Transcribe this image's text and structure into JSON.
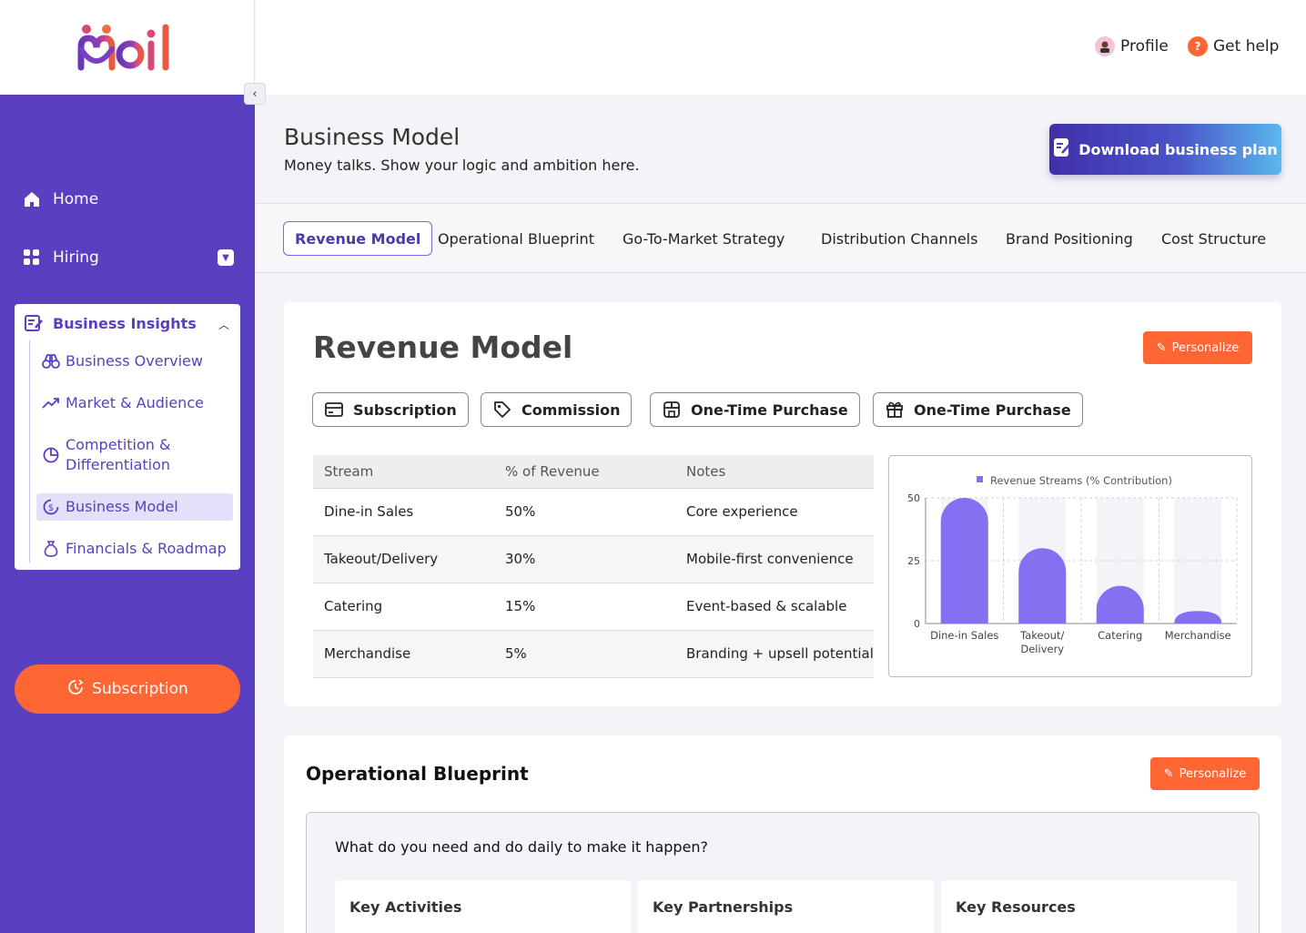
{
  "brand": {
    "logo_text": "moil"
  },
  "sidebar": {
    "home_label": "Home",
    "hiring_label": "Hiring",
    "insights_label": "Business Insights",
    "items": [
      {
        "label": "Business Overview"
      },
      {
        "label": "Market & Audience"
      },
      {
        "label": "Competition & Differentiation"
      },
      {
        "label": "Business Model"
      },
      {
        "label": "Financials & Roadmap"
      }
    ],
    "subscription_label": "Subscription"
  },
  "header": {
    "profile_label": "Profile",
    "help_label": "Get help"
  },
  "page": {
    "title": "Business Model",
    "subtitle": "Money talks. Show your logic and ambition here.",
    "download_label": "Download business plan"
  },
  "tabs": [
    {
      "label": "Revenue Model"
    },
    {
      "label": "Operational Blueprint"
    },
    {
      "label": "Go-To-Market Strategy"
    },
    {
      "label": "Distribution Channels"
    },
    {
      "label": "Brand Positioning"
    },
    {
      "label": "Cost Structure"
    }
  ],
  "revenue": {
    "title": "Revenue Model",
    "personalize_label": "Personalize",
    "chips": [
      "Subscription",
      "Commission",
      "One-Time Purchase",
      "One-Time Purchase"
    ],
    "table": {
      "headers": [
        "Stream",
        "% of Revenue",
        "Notes"
      ],
      "rows": [
        [
          "Dine-in Sales",
          "50%",
          "Core experience"
        ],
        [
          "Takeout/Delivery",
          "30%",
          "Mobile-first convenience"
        ],
        [
          "Catering",
          "15%",
          "Event-based & scalable"
        ],
        [
          "Merchandise",
          "5%",
          "Branding + upsell potential"
        ]
      ]
    }
  },
  "chart_data": {
    "type": "bar",
    "categories": [
      "Dine-in Sales",
      "Takeout/ Delivery",
      "Catering",
      "Merchandise"
    ],
    "series": [
      {
        "name": "Revenue Streams (% Contribution)",
        "values": [
          50,
          30,
          15,
          5
        ]
      }
    ],
    "yticks": [
      0,
      25,
      50
    ],
    "ylim": [
      0,
      50
    ],
    "legend": "top",
    "grid": true,
    "color": "#8470f0"
  },
  "operational": {
    "title": "Operational Blueprint",
    "personalize_label": "Personalize",
    "question": "What do you need and do daily to make it happen?",
    "columns": [
      "Key Activities",
      "Key Partnerships",
      "Key Resources"
    ]
  },
  "colors": {
    "sidebar": "#5a3fc0",
    "accent": "#ff6633"
  }
}
